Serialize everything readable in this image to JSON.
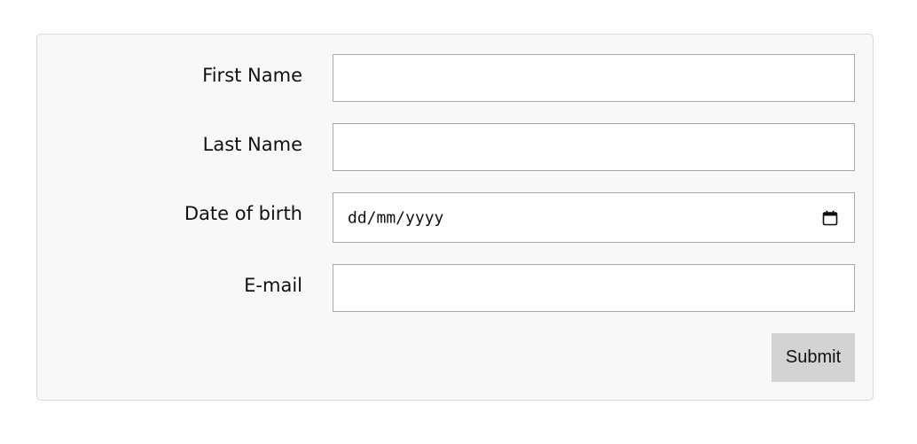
{
  "form": {
    "fields": [
      {
        "label": "First Name",
        "value": "",
        "type": "text"
      },
      {
        "label": "Last Name",
        "value": "",
        "type": "text"
      },
      {
        "label": "Date of birth",
        "placeholder": "dd/mm/yyyy",
        "type": "date"
      },
      {
        "label": "E-mail",
        "value": "",
        "type": "email"
      }
    ],
    "submit_label": "Submit"
  },
  "colors": {
    "card_background": "#f8f8f8",
    "card_border": "#d9d9d9",
    "field_border": "#a8a8a8",
    "button_background": "#d3d3d3"
  },
  "icons": {
    "date_picker": "calendar-icon"
  }
}
